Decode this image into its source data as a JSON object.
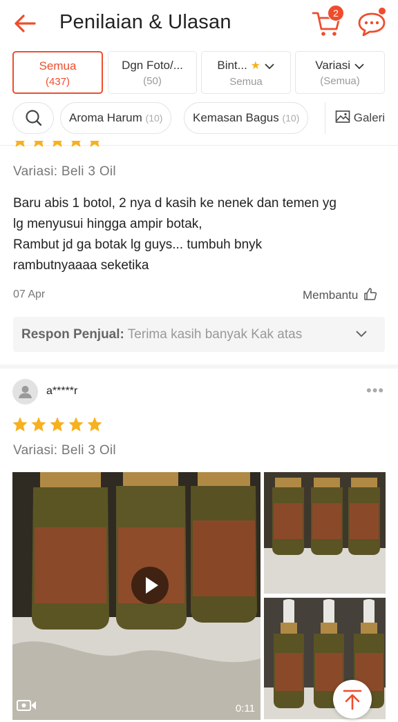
{
  "header": {
    "title": "Penilaian & Ulasan",
    "cart_count": "2"
  },
  "filters": [
    {
      "label": "Semua",
      "sub": "(437)"
    },
    {
      "label": "Dgn Foto/...",
      "sub": "(50)"
    },
    {
      "label": "Bint...",
      "sub": "Semua"
    },
    {
      "label": "Variasi",
      "sub": "(Semua)"
    }
  ],
  "keywords": [
    {
      "label": "Aroma Harum",
      "count": "(10)"
    },
    {
      "label": "Kemasan Bagus",
      "count": "(10)"
    }
  ],
  "galeri_label": "Galeri",
  "review1": {
    "rating": 5,
    "variasi": "Variasi: Beli 3 Oil",
    "text_lines": [
      "Baru abis 1 botol, 2 nya d kasih ke nenek dan temen yg",
      "lg menyusui hingga ampir botak,",
      "Rambut jd ga botak lg guys... tumbuh bnyk",
      "rambutnyaaaa seketika"
    ],
    "date": "07 Apr",
    "helpful_label": "Membantu",
    "seller_response_label": "Respon Penjual:",
    "seller_response_text": "Terima kasih banyak Kak atas"
  },
  "review2": {
    "username": "a*****r",
    "rating": 5,
    "variasi": "Variasi: Beli 3 Oil",
    "video_duration": "0:11"
  },
  "colors": {
    "accent": "#ee4d2d",
    "star": "#f7b01e"
  }
}
